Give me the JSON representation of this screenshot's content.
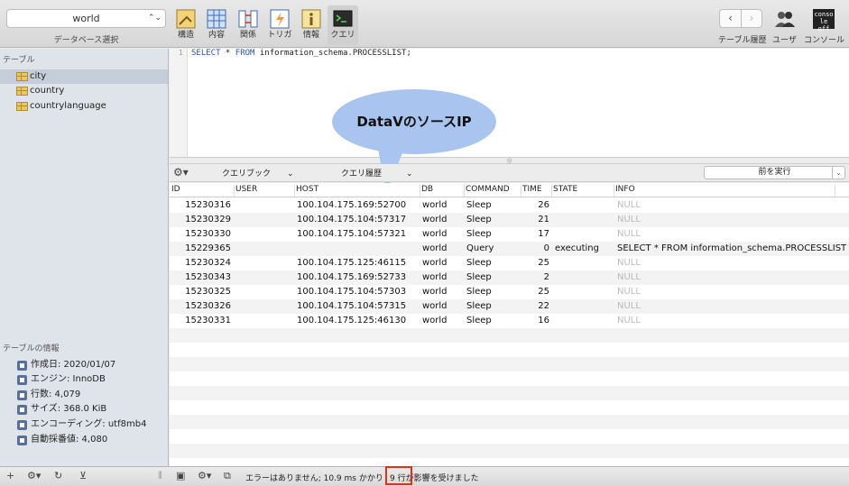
{
  "toolbar": {
    "database": "world",
    "database_label": "データベース選択",
    "buttons": [
      {
        "label": "構造",
        "icon": "structure-icon"
      },
      {
        "label": "内容",
        "icon": "content-icon"
      },
      {
        "label": "関係",
        "icon": "relations-icon"
      },
      {
        "label": "トリガ",
        "icon": "triggers-icon"
      },
      {
        "label": "情報",
        "icon": "info-icon"
      },
      {
        "label": "クエリ",
        "icon": "query-icon"
      }
    ],
    "history_label": "テーブル履歴",
    "users_label": "ユーザ",
    "console_label": "コンソール",
    "console_icon_text": "conso le off"
  },
  "sidebar": {
    "tables_header": "テーブル",
    "tables": [
      "city",
      "country",
      "countrylanguage"
    ],
    "selected": "city",
    "info_header": "テーブルの情報",
    "info": [
      "作成日: 2020/01/07",
      "エンジン: InnoDB",
      "行数: 4,079",
      "サイズ: 368.0 KiB",
      "エンコーディング: utf8mb4",
      "自動採番値: 4,080"
    ]
  },
  "editor": {
    "line_number": "1",
    "sql_kw1": "SELECT",
    "sql_mid": " * ",
    "sql_kw2": "FROM",
    "sql_rest": " information_schema.PROCESSLIST;"
  },
  "annotation": {
    "callout_text": "DataVのソースIP"
  },
  "query_bar": {
    "favorites": "クエリブック",
    "history": "クエリ履歴",
    "run_previous": "前を実行"
  },
  "results": {
    "columns": [
      "ID",
      "USER",
      "HOST",
      "DB",
      "COMMAND",
      "TIME",
      "STATE",
      "INFO"
    ],
    "rows": [
      {
        "id": "15230316",
        "user": "",
        "host": "100.104.175.169:52700",
        "db": "world",
        "command": "Sleep",
        "time": "26",
        "state": "",
        "info": "NULL"
      },
      {
        "id": "15230329",
        "user": "",
        "host": "100.104.175.104:57317",
        "db": "world",
        "command": "Sleep",
        "time": "21",
        "state": "",
        "info": "NULL"
      },
      {
        "id": "15230330",
        "user": "",
        "host": "100.104.175.104:57321",
        "db": "world",
        "command": "Sleep",
        "time": "17",
        "state": "",
        "info": "NULL"
      },
      {
        "id": "15229365",
        "user": "",
        "host": "",
        "db": "world",
        "command": "Query",
        "time": "0",
        "state": "executing",
        "info": "SELECT * FROM information_schema.PROCESSLIST"
      },
      {
        "id": "15230324",
        "user": "",
        "host": "100.104.175.125:46115",
        "db": "world",
        "command": "Sleep",
        "time": "25",
        "state": "",
        "info": "NULL"
      },
      {
        "id": "15230343",
        "user": "",
        "host": "100.104.175.169:52733",
        "db": "world",
        "command": "Sleep",
        "time": "2",
        "state": "",
        "info": "NULL"
      },
      {
        "id": "15230325",
        "user": "",
        "host": "100.104.175.104:57303",
        "db": "world",
        "command": "Sleep",
        "time": "25",
        "state": "",
        "info": "NULL"
      },
      {
        "id": "15230326",
        "user": "",
        "host": "100.104.175.104:57315",
        "db": "world",
        "command": "Sleep",
        "time": "22",
        "state": "",
        "info": "NULL"
      },
      {
        "id": "15230331",
        "user": "",
        "host": "100.104.175.125:46130",
        "db": "world",
        "command": "Sleep",
        "time": "16",
        "state": "",
        "info": "NULL"
      }
    ]
  },
  "status": {
    "message": "エラーはありません; 10.9 ms かかり",
    "rows_affected": "9 行が影響を受けました"
  },
  "colors": {
    "highlight": "#e0301e",
    "callout": "#a9c4ef",
    "selection": "#c4cdd8"
  }
}
